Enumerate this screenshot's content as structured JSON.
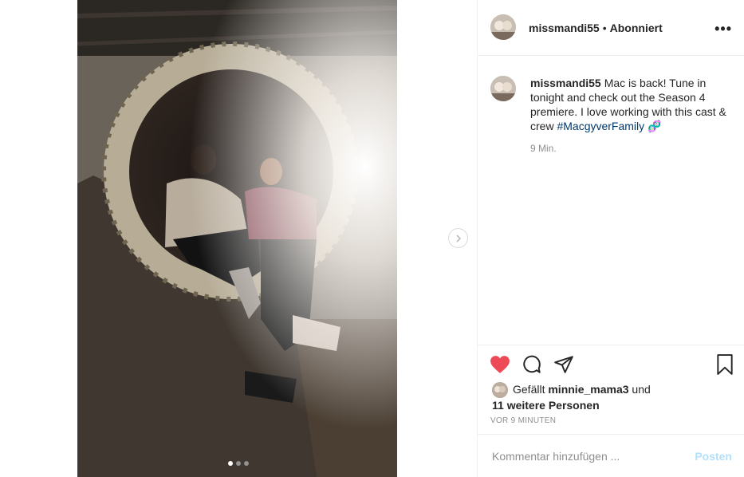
{
  "post": {
    "username": "missmandi55",
    "follow_state": "Abonniert",
    "caption_user": "missmandi55",
    "caption_text": "Mac is back! Tune in tonight and check out the Season 4 premiere. I love working with this cast & crew ",
    "caption_tag": "#MacgyverFamily",
    "caption_emoji": "🧬",
    "caption_time": "9 Min.",
    "likes_prefix": "Gefällt ",
    "likes_user": "minnie_mama3",
    "likes_mid": " und",
    "likes_count_text": "11 weitere Personen",
    "time_ago": "VOR 9 MINUTEN",
    "comment_placeholder": "Kommentar hinzufügen ...",
    "post_label": "Posten",
    "liked": true
  },
  "carousel": {
    "count": 3,
    "active_index": 0
  },
  "colors": {
    "heart": "#ed4956",
    "link": "#00376b",
    "post_button": "#b2dffc",
    "muted": "#8e8e8e"
  },
  "icons": [
    "heart-icon",
    "comment-icon",
    "share-icon",
    "bookmark-icon",
    "more-icon",
    "chevron-right-icon"
  ]
}
